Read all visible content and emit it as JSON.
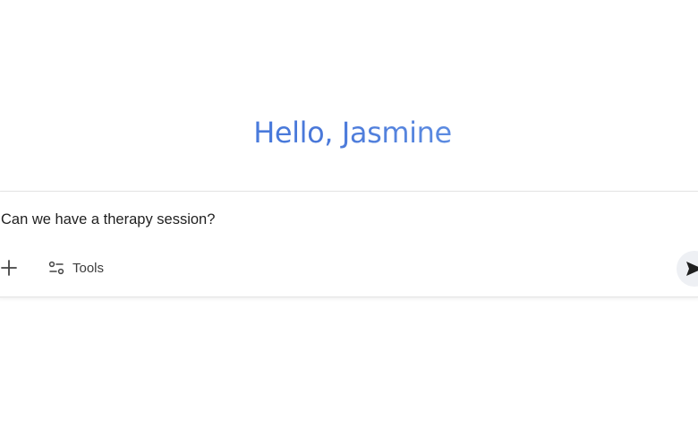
{
  "greeting": {
    "text": "Hello, Jasmine"
  },
  "composer": {
    "input_value": "Can we have a therapy session?",
    "tools_label": "Tools",
    "plus_icon": "plus-icon",
    "tools_icon": "tune-icon",
    "send_icon": "send-icon"
  },
  "colors": {
    "greeting_start": "#4486e6",
    "greeting_end": "#7fb0f0",
    "text": "#1f1f1f",
    "border": "#e3e3e3",
    "send_bg": "#eef0f4"
  }
}
